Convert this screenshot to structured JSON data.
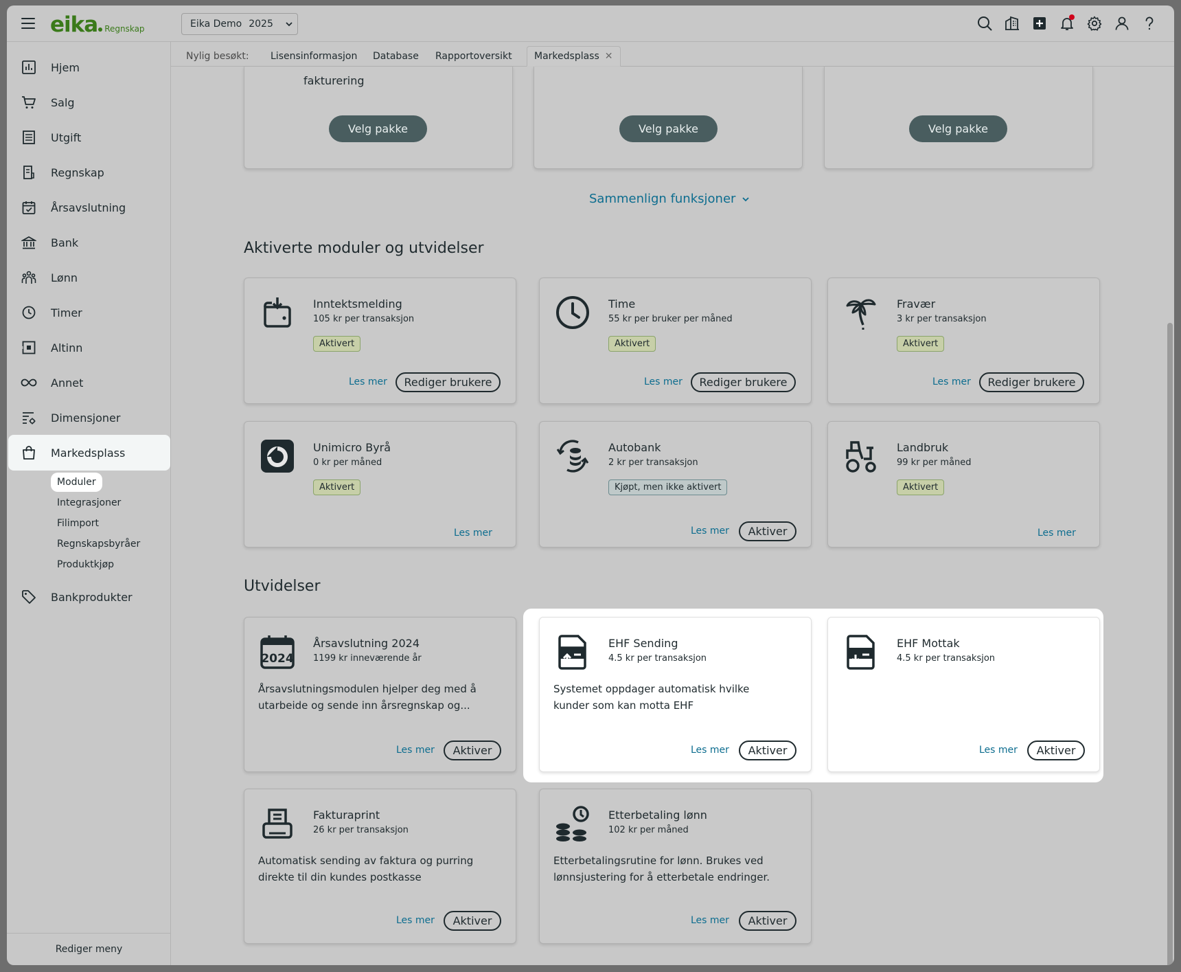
{
  "header": {
    "logo_word": "eika",
    "logo_sub": "Regnskap",
    "company": "Eika Demo",
    "year": "2025"
  },
  "tabs": {
    "label": "Nylig besøkt:",
    "items": [
      "Lisensinformasjon",
      "Database",
      "Rapportoversikt",
      "Markedsplass"
    ]
  },
  "sidebar": {
    "items": [
      "Hjem",
      "Salg",
      "Utgift",
      "Regnskap",
      "Årsavslutning",
      "Bank",
      "Lønn",
      "Timer",
      "Altinn",
      "Annet",
      "Dimensjoner",
      "Markedsplass",
      "Bankprodukter"
    ],
    "sub_items": [
      "Moduler",
      "Integrasjoner",
      "Filimport",
      "Regnskapsbyråer",
      "Produktkjøp"
    ],
    "edit_menu": "Rediger meny"
  },
  "packages": {
    "partial_text": "fakturering",
    "button": "Velg pakke",
    "compare": "Sammenlign funksjoner"
  },
  "sections": {
    "activated": "Aktiverte moduler og utvidelser",
    "extensions": "Utvidelser"
  },
  "labels": {
    "les_mer": "Les mer",
    "rediger": "Rediger brukere",
    "aktiver": "Aktiver"
  },
  "modules": [
    {
      "title": "Inntektsmelding",
      "price": "105 kr per transaksjon",
      "status": "Aktivert",
      "icon": "wallet-icon"
    },
    {
      "title": "Time",
      "price": "55 kr per bruker per måned",
      "status": "Aktivert",
      "icon": "clock-icon"
    },
    {
      "title": "Fravær",
      "price": "3 kr per transaksjon",
      "status": "Aktivert",
      "icon": "palm-tree-icon"
    },
    {
      "title": "Unimicro Byrå",
      "price": "0 kr per måned",
      "status": "Aktivert",
      "icon": "unimicro-icon"
    },
    {
      "title": "Autobank",
      "price": "2 kr per transaksjon",
      "status": "Kjøpt, men ikke aktivert",
      "icon": "coins-sync-icon"
    },
    {
      "title": "Landbruk",
      "price": "99 kr per måned",
      "status": "Aktivert",
      "icon": "tractor-icon"
    }
  ],
  "extensions": [
    {
      "title": "Årsavslutning 2024",
      "price": "1199 kr inneværende år",
      "desc": "Årsavslutningsmodulen hjelper deg med å utarbeide og sende inn årsregnskap og...",
      "icon": "calendar-2024-icon",
      "calendar_text": "2024"
    },
    {
      "title": "EHF Sending",
      "price": "4.5 kr per transaksjon",
      "desc": "Systemet oppdager automatisk hvilke kunder som kan motta EHF",
      "icon": "ehf-send-icon"
    },
    {
      "title": "EHF Mottak",
      "price": "4.5 kr per transaksjon",
      "desc": "",
      "icon": "ehf-receive-icon"
    },
    {
      "title": "Fakturaprint",
      "price": "26 kr per transaksjon",
      "desc": "Automatisk sending av faktura og purring direkte til din kundes postkasse",
      "icon": "printer-icon"
    },
    {
      "title": "Etterbetaling lønn",
      "price": "102 kr per måned",
      "desc": "Etterbetalingsrutine for lønn. Brukes ved lønnsjustering for å etterbetale endringer.",
      "icon": "coins-clock-icon"
    }
  ],
  "colors": {
    "brand": "#3a7a1a",
    "link": "#0d6d8f",
    "primary_button": "#495d5f",
    "notification": "#d0021b"
  }
}
